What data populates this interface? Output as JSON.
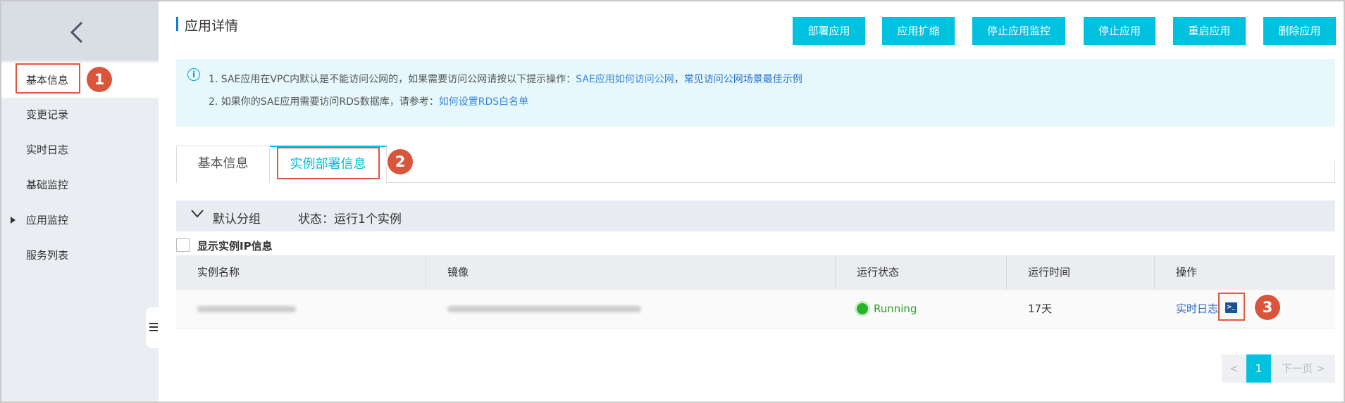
{
  "sidebar": {
    "back_icon": "chevron-left-icon",
    "items": [
      {
        "label": "基本信息",
        "active": true
      },
      {
        "label": "变更记录"
      },
      {
        "label": "实时日志"
      },
      {
        "label": "基础监控"
      },
      {
        "label": "应用监控",
        "expandable": true
      },
      {
        "label": "服务列表"
      }
    ]
  },
  "header": {
    "title": "应用详情",
    "buttons": [
      "部署应用",
      "应用扩缩",
      "停止应用监控",
      "停止应用",
      "重启应用",
      "删除应用"
    ]
  },
  "notice": {
    "line1_text": "1. SAE应用在VPC内默认是不能访问公网的，如果需要访问公网请按以下提示操作：",
    "line1_link1": "SAE应用如何访问公网",
    "line1_sep": "，",
    "line1_link2": "常见访问公网场景最佳示例",
    "line2_text": "2. 如果你的SAE应用需要访问RDS数据库，请参考：",
    "line2_link": "如何设置RDS白名单"
  },
  "tabs": [
    {
      "label": "基本信息"
    },
    {
      "label": "实例部署信息",
      "active": true
    }
  ],
  "group": {
    "name": "默认分组",
    "status": "状态：运行1个实例"
  },
  "show_ip_label": "显示实例IP信息",
  "table": {
    "columns": [
      "实例名称",
      "镜像",
      "运行状态",
      "运行时间",
      "操作"
    ],
    "rows": [
      {
        "status": "Running",
        "uptime": "17天",
        "action": "实时日志"
      }
    ]
  },
  "pagination": {
    "prev": "<",
    "current": "1",
    "next": "下一页 >"
  },
  "annotations": [
    "1",
    "2",
    "3"
  ],
  "colors": {
    "accent": "#00c1de",
    "annotation": "#d9553c",
    "running": "#2bb22b",
    "link": "#3c86d8"
  }
}
